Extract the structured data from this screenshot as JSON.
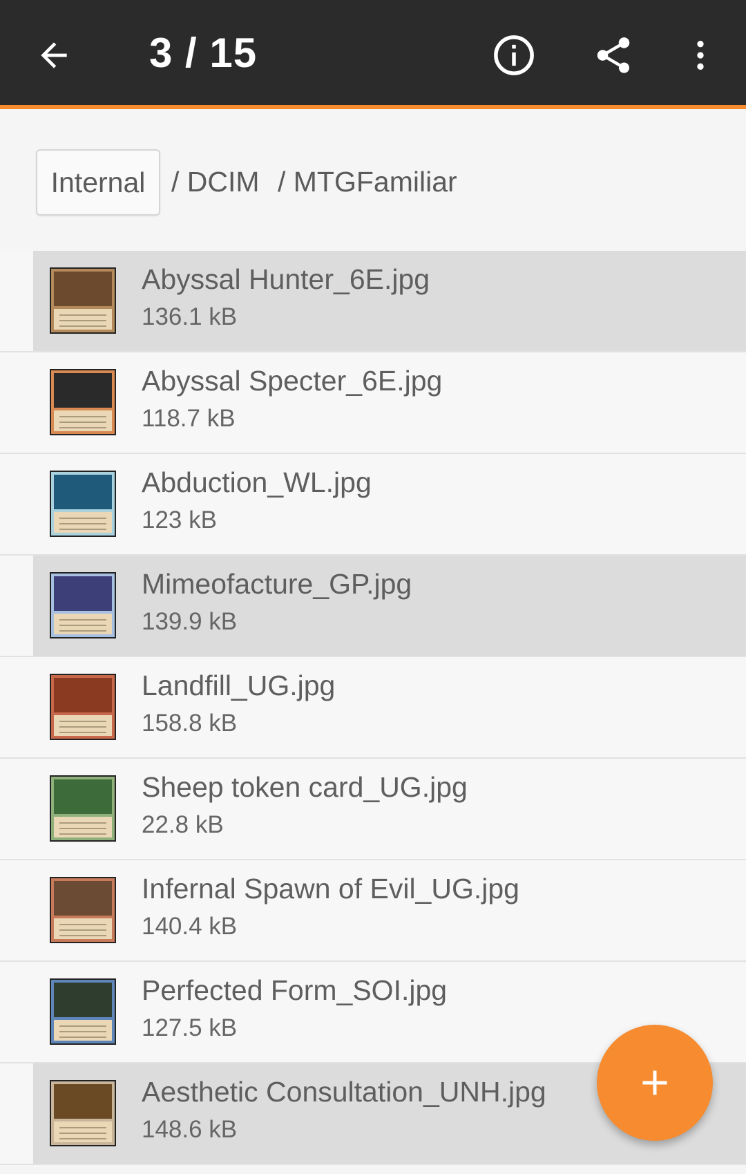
{
  "appbar": {
    "title": "3 / 15",
    "back_icon": "arrow-left-icon",
    "info_icon": "info-icon",
    "share_icon": "share-icon",
    "more_icon": "more-vert-icon",
    "background": "#2b2b2b",
    "accent": "#f68b2f"
  },
  "breadcrumb": {
    "root": "Internal",
    "items": [
      "/ DCIM",
      "/ MTGFamiliar"
    ]
  },
  "files": [
    {
      "name": "Abyssal Hunter_6E.jpg",
      "size": "136.1 kB",
      "selected": true,
      "art": "#6b4a2e",
      "frame": "#b58a5a"
    },
    {
      "name": "Abyssal Specter_6E.jpg",
      "size": "118.7 kB",
      "selected": false,
      "art": "#2a2a2a",
      "frame": "#d98a52"
    },
    {
      "name": "Abduction_WL.jpg",
      "size": "123 kB",
      "selected": false,
      "art": "#1f5a7a",
      "frame": "#a9d1de"
    },
    {
      "name": "Mimeofacture_GP.jpg",
      "size": "139.9 kB",
      "selected": true,
      "art": "#3c3f78",
      "frame": "#a7bfe0"
    },
    {
      "name": "Landfill_UG.jpg",
      "size": "158.8 kB",
      "selected": false,
      "art": "#8b3a22",
      "frame": "#c8684a"
    },
    {
      "name": "Sheep token card_UG.jpg",
      "size": "22.8 kB",
      "selected": false,
      "art": "#3d6b3a",
      "frame": "#8fb07a"
    },
    {
      "name": "Infernal Spawn of Evil_UG.jpg",
      "size": "140.4 kB",
      "selected": false,
      "art": "#6b4b34",
      "frame": "#c87b5a"
    },
    {
      "name": "Perfected Form_SOI.jpg",
      "size": "127.5 kB",
      "selected": false,
      "art": "#2f3d2f",
      "frame": "#5e86b8"
    },
    {
      "name": "Aesthetic Consultation_UNH.jpg",
      "size": "148.6 kB",
      "selected": true,
      "art": "#6a4a24",
      "frame": "#c9b69a"
    }
  ],
  "fab": {
    "icon": "plus-icon",
    "color": "#f68b2f"
  }
}
